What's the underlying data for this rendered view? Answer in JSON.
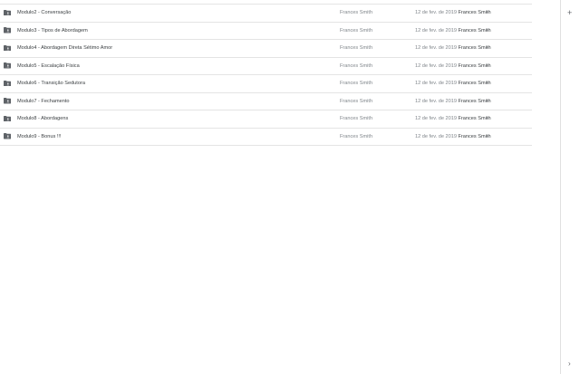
{
  "files": [
    {
      "name": "Modulo2 - Conversação",
      "owner": "Frances Smith",
      "date": "12 de fev. de 2019",
      "modified_by": "Frances Smith",
      "size": "–"
    },
    {
      "name": "Modulo3 - Tipos de Abordagem",
      "owner": "Frances Smith",
      "date": "12 de fev. de 2019",
      "modified_by": "Frances Smith",
      "size": "–"
    },
    {
      "name": "Modulo4 - Abordagem Direta Sétimo Amor",
      "owner": "Frances Smith",
      "date": "12 de fev. de 2019",
      "modified_by": "Frances Smith",
      "size": "–"
    },
    {
      "name": "Modulo5 - Escalação Física",
      "owner": "Frances Smith",
      "date": "12 de fev. de 2019",
      "modified_by": "Frances Smith",
      "size": "–"
    },
    {
      "name": "Modulo6 - Transição Sedutora",
      "owner": "Frances Smith",
      "date": "12 de fev. de 2019",
      "modified_by": "Frances Smith",
      "size": "–"
    },
    {
      "name": "Modulo7 - Fechamento",
      "owner": "Frances Smith",
      "date": "12 de fev. de 2019",
      "modified_by": "Frances Smith",
      "size": "–"
    },
    {
      "name": "Modulo8 - Abordagens",
      "owner": "Frances Smith",
      "date": "12 de fev. de 2019",
      "modified_by": "Frances Smith",
      "size": "–"
    },
    {
      "name": "Modulo9 - Bonus !!!",
      "owner": "Frances Smith",
      "date": "12 de fev. de 2019",
      "modified_by": "Frances Smith",
      "size": "–"
    }
  ],
  "rail": {
    "add_icon": "plus-icon",
    "add_glyph": "+",
    "expand_icon": "chevron-right-icon",
    "expand_glyph": "›"
  },
  "colors": {
    "folder": "#5f6368",
    "divider": "#e4e4e4"
  }
}
